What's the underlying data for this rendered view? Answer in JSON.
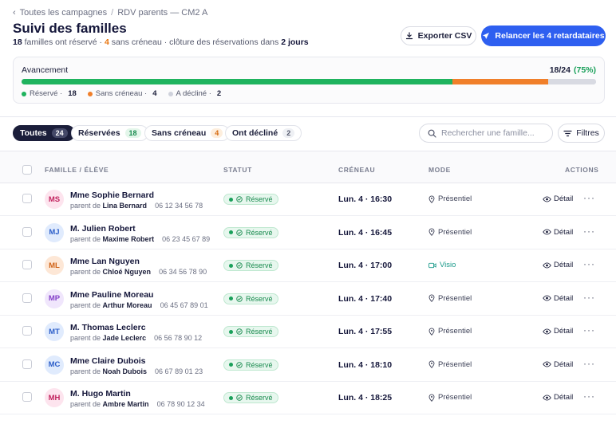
{
  "breadcrumb": {
    "back": "Toutes les campagnes",
    "separator": "/",
    "current": "RDV parents — CM2 A"
  },
  "header": {
    "title": "Suivi des familles",
    "subtitle_parts": {
      "reserved_count": "18",
      "reserved_text": " familles ont réservé · ",
      "no_slot_count": "4",
      "no_slot_text": " sans créneau · clôture des réservations dans ",
      "closing": "2 jours"
    },
    "export_label": "Exporter CSV",
    "relance_label": "Relancer les 4 retardataires"
  },
  "progress": {
    "label": "Avancement",
    "count": "18/24",
    "percent_text": "(75%)",
    "total": 24,
    "segments": [
      {
        "name": "reserved",
        "value": 18,
        "color": "#1fb35e"
      },
      {
        "name": "no_slot",
        "value": 4,
        "color": "#f07f2a"
      },
      {
        "name": "declined",
        "value": 2,
        "color": "#d8dae2"
      }
    ],
    "legend": [
      {
        "label": "Réservé ·",
        "count": "18",
        "color": "#1fb35e"
      },
      {
        "label": "Sans créneau ·",
        "count": "4",
        "color": "#f07f2a"
      },
      {
        "label": "A décliné ·",
        "count": "2",
        "color": "#cfd2dc"
      }
    ]
  },
  "tabs": [
    {
      "label": "Toutes",
      "count": "24",
      "active": true,
      "count_bg": "#454968",
      "count_fg": "#ffffff"
    },
    {
      "label": "Réservées",
      "count": "18",
      "active": false,
      "count_bg": "#e3f6ea",
      "count_fg": "#178a4d"
    },
    {
      "label": "Sans créneau",
      "count": "4",
      "active": false,
      "count_bg": "#fdeedd",
      "count_fg": "#d66b10"
    },
    {
      "label": "Ont décliné",
      "count": "2",
      "active": false,
      "count_bg": "#eef0f4",
      "count_fg": "#54586c"
    }
  ],
  "search": {
    "placeholder": "Rechercher une famille..."
  },
  "filters_label": "Filtres",
  "table": {
    "headers": {
      "family": "FAMILLE / ÉLÈVE",
      "status": "STATUT",
      "slot": "CRÉNEAU",
      "mode": "MODE",
      "actions": "ACTIONS"
    },
    "detail_label": "Détail",
    "more_label": "···",
    "parent_prefix": "parent de",
    "rows": [
      {
        "initials": "MS",
        "av_bg": "#fde4ee",
        "av_fg": "#c2245f",
        "name": "Mme Sophie Bernard",
        "child": "Lina Bernard",
        "phone": "06 12 34 56 78",
        "status": "Réservé",
        "slot": "Lun. 4 · 16:30",
        "mode": "Présentiel",
        "mode_type": "presentiel"
      },
      {
        "initials": "MJ",
        "av_bg": "#e0ebfd",
        "av_fg": "#2d5fc9",
        "name": "M. Julien Robert",
        "child": "Maxime Robert",
        "phone": "06 23 45 67 89",
        "status": "Réservé",
        "slot": "Lun. 4 · 16:45",
        "mode": "Présentiel",
        "mode_type": "presentiel"
      },
      {
        "initials": "ML",
        "av_bg": "#fde7d6",
        "av_fg": "#d06317",
        "name": "Mme Lan Nguyen",
        "child": "Chloé Nguyen",
        "phone": "06 34 56 78 90",
        "status": "Réservé",
        "slot": "Lun. 4 · 17:00",
        "mode": "Visio",
        "mode_type": "visio"
      },
      {
        "initials": "MP",
        "av_bg": "#f0e6fc",
        "av_fg": "#8440c9",
        "name": "Mme Pauline Moreau",
        "child": "Arthur Moreau",
        "phone": "06 45 67 89 01",
        "status": "Réservé",
        "slot": "Lun. 4 · 17:40",
        "mode": "Présentiel",
        "mode_type": "presentiel"
      },
      {
        "initials": "MT",
        "av_bg": "#e0ebfd",
        "av_fg": "#2d5fc9",
        "name": "M. Thomas Leclerc",
        "child": "Jade Leclerc",
        "phone": "06 56 78 90 12",
        "status": "Réservé",
        "slot": "Lun. 4 · 17:55",
        "mode": "Présentiel",
        "mode_type": "presentiel"
      },
      {
        "initials": "MC",
        "av_bg": "#e0ebfd",
        "av_fg": "#2d5fc9",
        "name": "Mme Claire Dubois",
        "child": "Noah Dubois",
        "phone": "06 67 89 01 23",
        "status": "Réservé",
        "slot": "Lun. 4 · 18:10",
        "mode": "Présentiel",
        "mode_type": "presentiel"
      },
      {
        "initials": "MH",
        "av_bg": "#fde4ee",
        "av_fg": "#c2245f",
        "name": "M. Hugo Martin",
        "child": "Ambre Martin",
        "phone": "06 78 90 12 34",
        "status": "Réservé",
        "slot": "Lun. 4 · 18:25",
        "mode": "Présentiel",
        "mode_type": "presentiel"
      }
    ]
  }
}
